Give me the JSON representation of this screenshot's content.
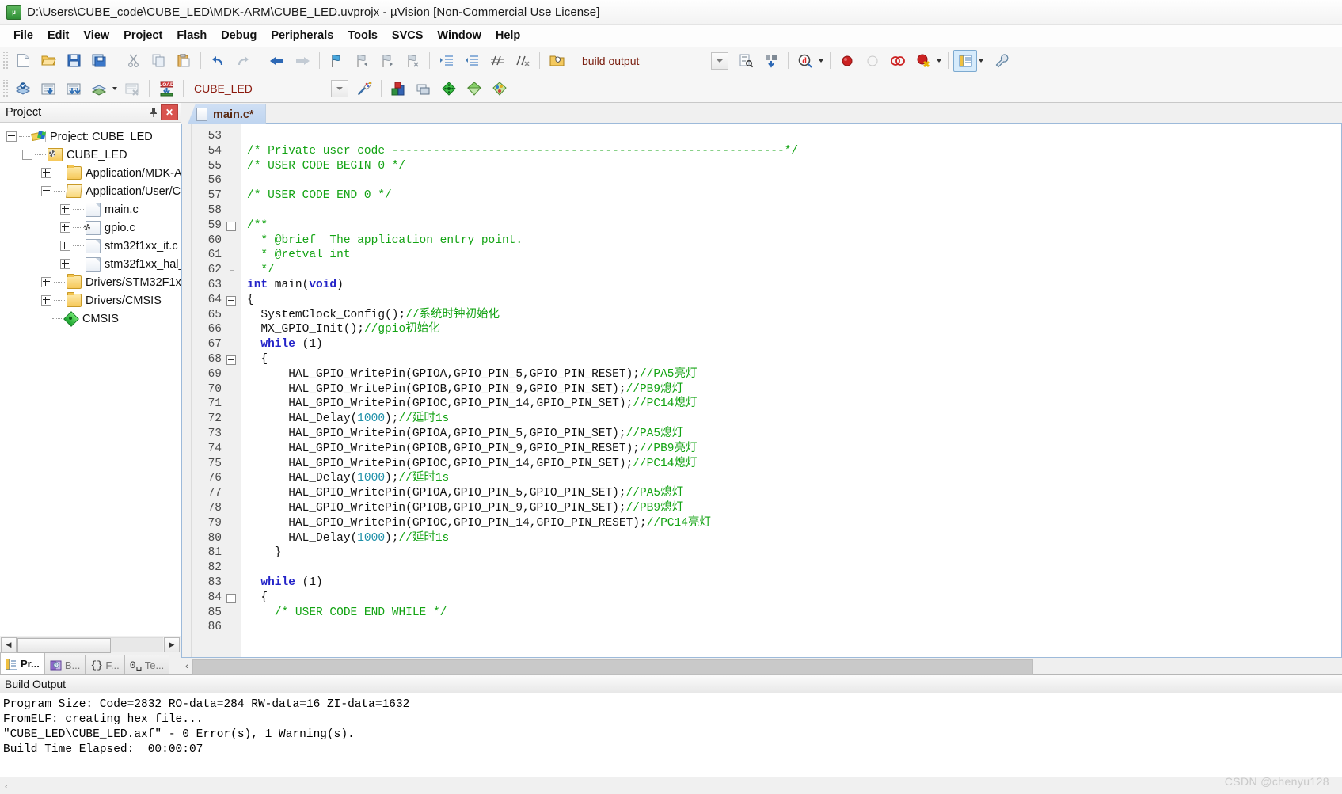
{
  "window": {
    "title": "D:\\Users\\CUBE_code\\CUBE_LED\\MDK-ARM\\CUBE_LED.uvprojx - µVision  [Non-Commercial Use License]",
    "app_icon": "uvision-icon"
  },
  "menubar": {
    "items": [
      {
        "label": "File"
      },
      {
        "label": "Edit"
      },
      {
        "label": "View"
      },
      {
        "label": "Project"
      },
      {
        "label": "Flash"
      },
      {
        "label": "Debug"
      },
      {
        "label": "Peripherals"
      },
      {
        "label": "Tools"
      },
      {
        "label": "SVCS"
      },
      {
        "label": "Window"
      },
      {
        "label": "Help"
      }
    ]
  },
  "toolbar_file": {
    "buttons": [
      {
        "name": "new-file-icon"
      },
      {
        "name": "open-file-icon"
      },
      {
        "name": "save-icon"
      },
      {
        "name": "save-all-icon"
      },
      {
        "name": "cut-icon"
      },
      {
        "name": "copy-icon"
      },
      {
        "name": "paste-icon"
      },
      {
        "name": "undo-icon"
      },
      {
        "name": "redo-icon"
      },
      {
        "name": "navigate-back-icon"
      },
      {
        "name": "navigate-forward-icon"
      },
      {
        "name": "bookmark-toggle-icon"
      },
      {
        "name": "bookmark-prev-icon"
      },
      {
        "name": "bookmark-next-icon"
      },
      {
        "name": "bookmark-clear-icon"
      },
      {
        "name": "indent-icon"
      },
      {
        "name": "outdent-icon"
      },
      {
        "name": "comment-icon"
      },
      {
        "name": "uncomment-icon"
      },
      {
        "name": "configure-build-output-icon"
      }
    ],
    "build_output_combo": {
      "value": "build output",
      "name": "build-output-select"
    },
    "after_combo": [
      {
        "name": "find-in-files-icon"
      },
      {
        "name": "insert-icon"
      },
      {
        "name": "debug-search-icon"
      },
      {
        "name": "insert-breakpoint-icon"
      },
      {
        "name": "kill-breakpoint-icon"
      },
      {
        "name": "disable-breakpoint-icon"
      },
      {
        "name": "kill-all-breakpoints-icon"
      },
      {
        "name": "window-layout-icon"
      }
    ]
  },
  "toolbar_build": {
    "buttons": [
      {
        "name": "translate-icon"
      },
      {
        "name": "build-icon"
      },
      {
        "name": "rebuild-icon"
      },
      {
        "name": "batch-build-icon"
      },
      {
        "name": "stop-build-icon"
      },
      {
        "name": "download-icon"
      }
    ],
    "target_combo": {
      "value": "CUBE_LED",
      "name": "target-select"
    },
    "right_buttons": [
      {
        "name": "manage-project-items-icon"
      },
      {
        "name": "options-for-target-icon"
      },
      {
        "name": "manage-components-icon"
      },
      {
        "name": "pack-installer-icon"
      },
      {
        "name": "run-to-main-icon"
      },
      {
        "name": "configuration-wizard-icon"
      }
    ]
  },
  "project_panel": {
    "title": "Project",
    "pin_icon": "pin-icon",
    "close_icon": "close-icon",
    "tree": [
      {
        "label": "Project: CUBE_LED",
        "indent": 0,
        "expander": "minus",
        "icon": "project-icon"
      },
      {
        "label": "CUBE_LED",
        "indent": 1,
        "expander": "minus",
        "icon": "target-icon"
      },
      {
        "label": "Application/MDK-A",
        "indent": 2,
        "expander": "plus",
        "icon": "folder-icon"
      },
      {
        "label": "Application/User/C",
        "indent": 2,
        "expander": "minus",
        "icon": "folder-open-icon"
      },
      {
        "label": "main.c",
        "indent": 3,
        "expander": "plus",
        "icon": "c-file-icon"
      },
      {
        "label": "gpio.c",
        "indent": 3,
        "expander": "plus",
        "icon": "c-file-gear-icon"
      },
      {
        "label": "stm32f1xx_it.c",
        "indent": 3,
        "expander": "plus",
        "icon": "c-file-icon"
      },
      {
        "label": "stm32f1xx_hal_",
        "indent": 3,
        "expander": "plus",
        "icon": "c-file-icon"
      },
      {
        "label": "Drivers/STM32F1xx_",
        "indent": 2,
        "expander": "plus",
        "icon": "folder-icon"
      },
      {
        "label": "Drivers/CMSIS",
        "indent": 2,
        "expander": "plus",
        "icon": "folder-icon"
      },
      {
        "label": "CMSIS",
        "indent": 2,
        "expander": "none",
        "icon": "cmsis-icon"
      }
    ],
    "hscroll": {
      "left_glyph": "◀",
      "right_glyph": "▶",
      "thumb_pct": 63
    },
    "tabs": [
      {
        "label": "Pr...",
        "icon": "project-tab-icon",
        "selected": true
      },
      {
        "label": "B...",
        "icon": "books-tab-icon",
        "selected": false
      },
      {
        "label": "F...",
        "icon": "functions-tab-icon",
        "selected": false
      },
      {
        "label": "Te...",
        "icon": "templates-tab-icon",
        "selected": false
      }
    ]
  },
  "editor": {
    "tabs": [
      {
        "label": "main.c*",
        "icon": "c-file-icon",
        "active": true
      }
    ],
    "first_line_number": 53,
    "hscroll": {
      "left_glyph": "‹",
      "thumb_pct": 73
    },
    "lines": [
      {
        "n": 53,
        "fold": "",
        "tokens": []
      },
      {
        "n": 54,
        "fold": "",
        "tokens": [
          {
            "t": "cm",
            "s": "/* Private user code ---------------------------------------------------------*/"
          }
        ]
      },
      {
        "n": 55,
        "fold": "",
        "tokens": [
          {
            "t": "cm",
            "s": "/* USER CODE BEGIN 0 */"
          }
        ]
      },
      {
        "n": 56,
        "fold": "",
        "tokens": []
      },
      {
        "n": 57,
        "fold": "",
        "tokens": [
          {
            "t": "cm",
            "s": "/* USER CODE END 0 */"
          }
        ]
      },
      {
        "n": 58,
        "fold": "",
        "tokens": []
      },
      {
        "n": 59,
        "fold": "box",
        "tokens": [
          {
            "t": "cm",
            "s": "/**"
          }
        ]
      },
      {
        "n": 60,
        "fold": "bar",
        "tokens": [
          {
            "t": "cm",
            "s": "  * @brief  The application entry point."
          }
        ]
      },
      {
        "n": 61,
        "fold": "bar",
        "tokens": [
          {
            "t": "cm",
            "s": "  * @retval int"
          }
        ]
      },
      {
        "n": 62,
        "fold": "end",
        "tokens": [
          {
            "t": "cm",
            "s": "  */"
          }
        ]
      },
      {
        "n": 63,
        "fold": "",
        "tokens": [
          {
            "t": "kw",
            "s": "int"
          },
          {
            "t": "pl",
            "s": " main("
          },
          {
            "t": "kw",
            "s": "void"
          },
          {
            "t": "pl",
            "s": ")"
          }
        ]
      },
      {
        "n": 64,
        "fold": "box",
        "tokens": [
          {
            "t": "pl",
            "s": "{"
          }
        ]
      },
      {
        "n": 65,
        "fold": "bar",
        "tokens": [
          {
            "t": "pl",
            "s": "  SystemClock_Config();"
          },
          {
            "t": "cm",
            "s": "//系统时钟初始化"
          }
        ]
      },
      {
        "n": 66,
        "fold": "bar",
        "tokens": [
          {
            "t": "pl",
            "s": "  MX_GPIO_Init();"
          },
          {
            "t": "cm",
            "s": "//gpio初始化"
          }
        ]
      },
      {
        "n": 67,
        "fold": "bar",
        "tokens": [
          {
            "t": "pl",
            "s": "  "
          },
          {
            "t": "kw",
            "s": "while"
          },
          {
            "t": "pl",
            "s": " (1)"
          }
        ]
      },
      {
        "n": 68,
        "fold": "box",
        "tokens": [
          {
            "t": "pl",
            "s": "  {"
          }
        ]
      },
      {
        "n": 69,
        "fold": "bar",
        "tokens": [
          {
            "t": "pl",
            "s": "      HAL_GPIO_WritePin(GPIOA,GPIO_PIN_5,GPIO_PIN_RESET);"
          },
          {
            "t": "cm",
            "s": "//PA5亮灯"
          }
        ]
      },
      {
        "n": 70,
        "fold": "bar",
        "tokens": [
          {
            "t": "pl",
            "s": "      HAL_GPIO_WritePin(GPIOB,GPIO_PIN_9,GPIO_PIN_SET);"
          },
          {
            "t": "cm",
            "s": "//PB9熄灯"
          }
        ]
      },
      {
        "n": 71,
        "fold": "bar",
        "tokens": [
          {
            "t": "pl",
            "s": "      HAL_GPIO_WritePin(GPIOC,GPIO_PIN_14,GPIO_PIN_SET);"
          },
          {
            "t": "cm",
            "s": "//PC14熄灯"
          }
        ]
      },
      {
        "n": 72,
        "fold": "bar",
        "tokens": [
          {
            "t": "pl",
            "s": "      HAL_Delay("
          },
          {
            "t": "num",
            "s": "1000"
          },
          {
            "t": "pl",
            "s": ");"
          },
          {
            "t": "cm",
            "s": "//延时1s"
          }
        ]
      },
      {
        "n": 73,
        "fold": "bar",
        "tokens": [
          {
            "t": "pl",
            "s": "      HAL_GPIO_WritePin(GPIOA,GPIO_PIN_5,GPIO_PIN_SET);"
          },
          {
            "t": "cm",
            "s": "//PA5熄灯"
          }
        ]
      },
      {
        "n": 74,
        "fold": "bar",
        "tokens": [
          {
            "t": "pl",
            "s": "      HAL_GPIO_WritePin(GPIOB,GPIO_PIN_9,GPIO_PIN_RESET);"
          },
          {
            "t": "cm",
            "s": "//PB9亮灯"
          }
        ]
      },
      {
        "n": 75,
        "fold": "bar",
        "tokens": [
          {
            "t": "pl",
            "s": "      HAL_GPIO_WritePin(GPIOC,GPIO_PIN_14,GPIO_PIN_SET);"
          },
          {
            "t": "cm",
            "s": "//PC14熄灯"
          }
        ]
      },
      {
        "n": 76,
        "fold": "bar",
        "tokens": [
          {
            "t": "pl",
            "s": "      HAL_Delay("
          },
          {
            "t": "num",
            "s": "1000"
          },
          {
            "t": "pl",
            "s": ");"
          },
          {
            "t": "cm",
            "s": "//延时1s"
          }
        ]
      },
      {
        "n": 77,
        "fold": "bar",
        "tokens": [
          {
            "t": "pl",
            "s": "      HAL_GPIO_WritePin(GPIOA,GPIO_PIN_5,GPIO_PIN_SET);"
          },
          {
            "t": "cm",
            "s": "//PA5熄灯"
          }
        ]
      },
      {
        "n": 78,
        "fold": "bar",
        "tokens": [
          {
            "t": "pl",
            "s": "      HAL_GPIO_WritePin(GPIOB,GPIO_PIN_9,GPIO_PIN_SET);"
          },
          {
            "t": "cm",
            "s": "//PB9熄灯"
          }
        ]
      },
      {
        "n": 79,
        "fold": "bar",
        "tokens": [
          {
            "t": "pl",
            "s": "      HAL_GPIO_WritePin(GPIOC,GPIO_PIN_14,GPIO_PIN_RESET);"
          },
          {
            "t": "cm",
            "s": "//PC14亮灯"
          }
        ]
      },
      {
        "n": 80,
        "fold": "bar",
        "tokens": [
          {
            "t": "pl",
            "s": "      HAL_Delay("
          },
          {
            "t": "num",
            "s": "1000"
          },
          {
            "t": "pl",
            "s": ");"
          },
          {
            "t": "cm",
            "s": "//延时1s"
          }
        ]
      },
      {
        "n": 81,
        "fold": "bar",
        "tokens": [
          {
            "t": "pl",
            "s": "    }"
          }
        ]
      },
      {
        "n": 82,
        "fold": "end",
        "tokens": []
      },
      {
        "n": 83,
        "fold": "",
        "tokens": [
          {
            "t": "pl",
            "s": "  "
          },
          {
            "t": "kw",
            "s": "while"
          },
          {
            "t": "pl",
            "s": " (1)"
          }
        ]
      },
      {
        "n": 84,
        "fold": "box",
        "tokens": [
          {
            "t": "pl",
            "s": "  {"
          }
        ]
      },
      {
        "n": 85,
        "fold": "bar",
        "tokens": [
          {
            "t": "pl",
            "s": "    "
          },
          {
            "t": "cm",
            "s": "/* USER CODE END WHILE */"
          }
        ]
      },
      {
        "n": 86,
        "fold": "bar",
        "tokens": []
      }
    ]
  },
  "build_output": {
    "title": "Build Output",
    "lines": [
      "Program Size: Code=2832 RO-data=284 RW-data=16 ZI-data=1632",
      "FromELF: creating hex file...",
      "\"CUBE_LED\\CUBE_LED.axf\" - 0 Error(s), 1 Warning(s).",
      "Build Time Elapsed:  00:00:07"
    ],
    "foot_glyph": "‹"
  },
  "watermark": {
    "text": "CSDN @chenyu128"
  },
  "colors": {
    "comment": "#13a313",
    "keyword": "#2323c8",
    "number": "#1d8fa8",
    "accent_tab": "#bed4ef",
    "close_button": "#d9534f"
  }
}
